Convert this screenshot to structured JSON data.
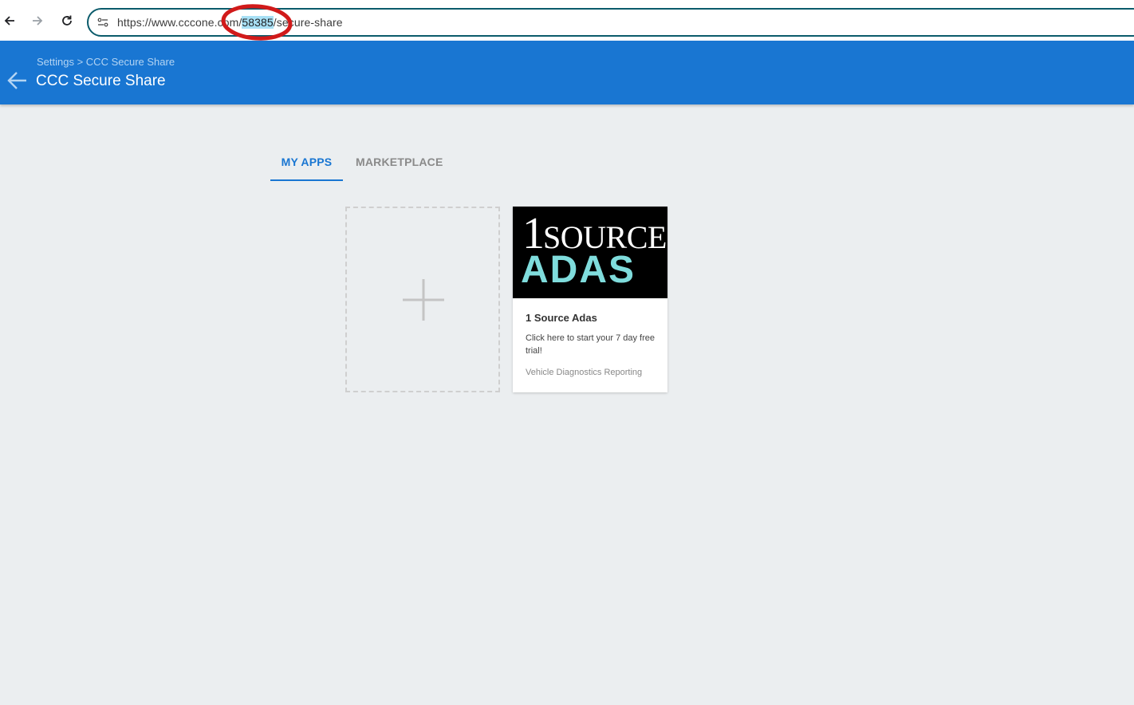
{
  "browser": {
    "url_prefix": "https://www.cccone.com/",
    "url_highlight": "58385",
    "url_suffix": "/secure-share"
  },
  "header": {
    "breadcrumb": "Settings > CCC Secure Share",
    "title": "CCC Secure Share"
  },
  "tabs": [
    {
      "label": "MY APPS",
      "active": true
    },
    {
      "label": "MARKETPLACE",
      "active": false
    }
  ],
  "apps": [
    {
      "logo_line1_number": "1",
      "logo_line1_word": "SOURCE",
      "logo_line2": "ADAS",
      "name": "1 Source Adas",
      "description": "Click here to start your 7 day free trial!",
      "category": "Vehicle Diagnostics Reporting"
    }
  ],
  "colors": {
    "header": "#1976d2",
    "page_background": "#ebeef0",
    "logo_accent": "#7fdcdc",
    "annotation": "#d11a1a"
  },
  "icons": [
    "back-arrow-icon",
    "forward-arrow-icon",
    "reload-icon",
    "site-info-icon",
    "header-back-arrow-icon",
    "plus-icon"
  ]
}
